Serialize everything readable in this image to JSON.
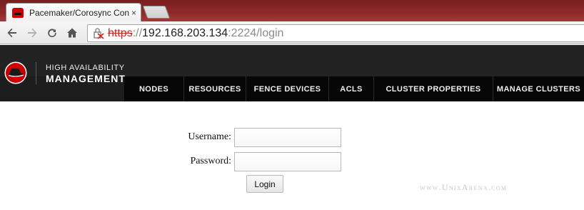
{
  "browser": {
    "tab": {
      "title": "Pacemaker/Corosync Conf",
      "close_glyph": "×"
    },
    "address_bar": {
      "scheme": "https",
      "separator": "://",
      "host": "192.168.203.134",
      "path": ":2224/login"
    },
    "icons": [
      "back-icon",
      "forward-icon",
      "reload-icon",
      "home-icon",
      "broken-lock-icon"
    ]
  },
  "header": {
    "brand_line1": "HIGH AVAILABILITY",
    "brand_line2": "MANAGEMENT",
    "nav": [
      {
        "label": "NODES"
      },
      {
        "label": "RESOURCES"
      },
      {
        "label": "FENCE DEVICES"
      },
      {
        "label": "ACLS"
      },
      {
        "label": "CLUSTER PROPERTIES"
      },
      {
        "label": "MANAGE CLUSTERS"
      }
    ]
  },
  "login": {
    "username_label": "Username:",
    "username_value": "",
    "password_label": "Password:",
    "password_value": "",
    "button_label": "Login"
  },
  "watermark": "www.UnixArena.com",
  "colors": {
    "header_bg": "#1d1d1d",
    "navbar_bg": "#060606",
    "logo_red": "#cc0000",
    "tabstrip_red": "#8f2a2a"
  }
}
